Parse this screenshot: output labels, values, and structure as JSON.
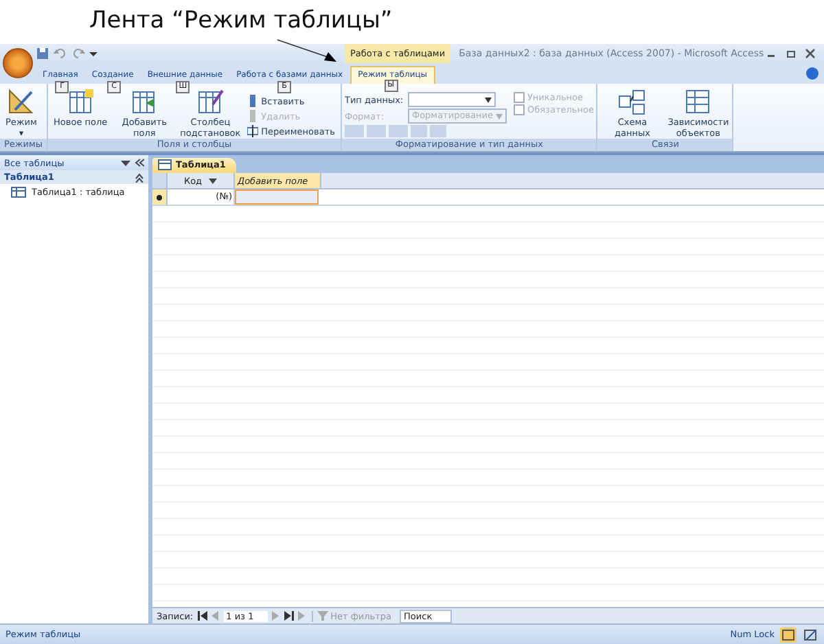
{
  "caption": "Лента “Режим таблицы”",
  "window": {
    "title": "База данных2 : база данных (Access 2007) - Microsoft Access",
    "context_header": "Работа с таблицами"
  },
  "tabs": [
    {
      "label": "Главная",
      "keytip": "Г",
      "selected": false,
      "contextual": false
    },
    {
      "label": "Создание",
      "keytip": "С",
      "selected": false,
      "contextual": false
    },
    {
      "label": "Внешние данные",
      "keytip": "Ш",
      "selected": false,
      "contextual": false
    },
    {
      "label": "Работа с базами данных",
      "keytip": "Б",
      "selected": false,
      "contextual": false
    },
    {
      "label": "Режим таблицы",
      "keytip": "Ы",
      "selected": true,
      "contextual": true
    }
  ],
  "ribbon": {
    "views": {
      "label": "Режим",
      "caret": "▾",
      "group": "Режимы"
    },
    "fields": {
      "group": "Поля и столбцы",
      "large": [
        {
          "label": "Новое поле",
          "kind": "new"
        },
        {
          "label": "Добавить поля",
          "kind": "add"
        },
        {
          "label": "Столбец подстановок",
          "kind": "lookup"
        }
      ],
      "small": [
        {
          "label": "Вставить",
          "disabled": false,
          "kind": "insert"
        },
        {
          "label": "Удалить",
          "disabled": true,
          "kind": "delete"
        },
        {
          "label": "Переименовать",
          "disabled": false,
          "kind": "rename"
        }
      ]
    },
    "format": {
      "group": "Форматирование и тип данных",
      "rows": [
        {
          "label": "Тип данных:",
          "disabled": false,
          "value": ""
        },
        {
          "label": "Формат:",
          "disabled": true,
          "value": "Форматирование"
        }
      ],
      "checks": [
        {
          "label": "Уникальное",
          "checked": false,
          "disabled": true
        },
        {
          "label": "Обязательное",
          "checked": false,
          "disabled": true
        }
      ]
    },
    "relations": {
      "group": "Связи",
      "buttons": [
        {
          "label": "Схема данных",
          "kind": "schema"
        },
        {
          "label": "Зависимости объектов",
          "kind": "deps"
        }
      ]
    }
  },
  "nav_pane": {
    "header": "Все таблицы",
    "group": "Таблица1",
    "items": [
      {
        "label": "Таблица1 : таблица"
      }
    ]
  },
  "document": {
    "tab": "Таблица1",
    "columns": [
      {
        "label": "Код",
        "kind": "field"
      },
      {
        "label": "Добавить поле",
        "kind": "add"
      }
    ],
    "new_row": [
      "(№)"
    ]
  },
  "record_nav": {
    "label": "Записи:",
    "position": "1 из 1",
    "filter": "Нет фильтра",
    "search": "Поиск"
  },
  "status_bar": {
    "text": "Режим таблицы",
    "indicator": "Num Lock"
  }
}
